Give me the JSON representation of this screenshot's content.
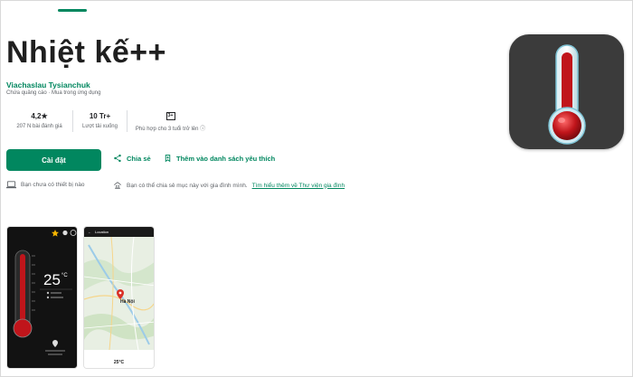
{
  "app": {
    "title": "Nhiệt kế++",
    "developer": "Viachaslau Tysianchuk",
    "tags": "Chứa quảng cáo · Mua trong ứng dụng"
  },
  "stats": {
    "rating_value": "4,2★",
    "rating_label": "207 N bài đánh giá",
    "downloads_value": "10 Tr+",
    "downloads_label": "Lượt tải xuống",
    "age_badge": "3+",
    "age_label": "Phù hợp cho 3 tuổi trở lên ⓘ"
  },
  "actions": {
    "install_label": "Cài đặt",
    "share_label": "Chia sẻ",
    "wishlist_label": "Thêm vào danh sách yêu thích"
  },
  "info": {
    "devices_text": "Bạn chưa có thiết bị nào",
    "family_text": "Bạn có thể chia sẻ mục này với gia đình mình.",
    "family_link": "Tìm hiểu thêm về Thư viện gia đình"
  },
  "screenshots": {
    "shot1_temp": "25",
    "shot1_unit": "°C",
    "shot2_header": "Location",
    "shot2_city": "Hà Nội",
    "shot2_temp": "25°C"
  },
  "colors": {
    "accent": "#01875f",
    "icon_bg": "#3b3b3b",
    "mercury": "#c0151b"
  },
  "icons": [
    "share-icon",
    "bookmark-plus-icon",
    "laptop-icon",
    "family-icon",
    "thermometer-icon",
    "info-icon"
  ]
}
